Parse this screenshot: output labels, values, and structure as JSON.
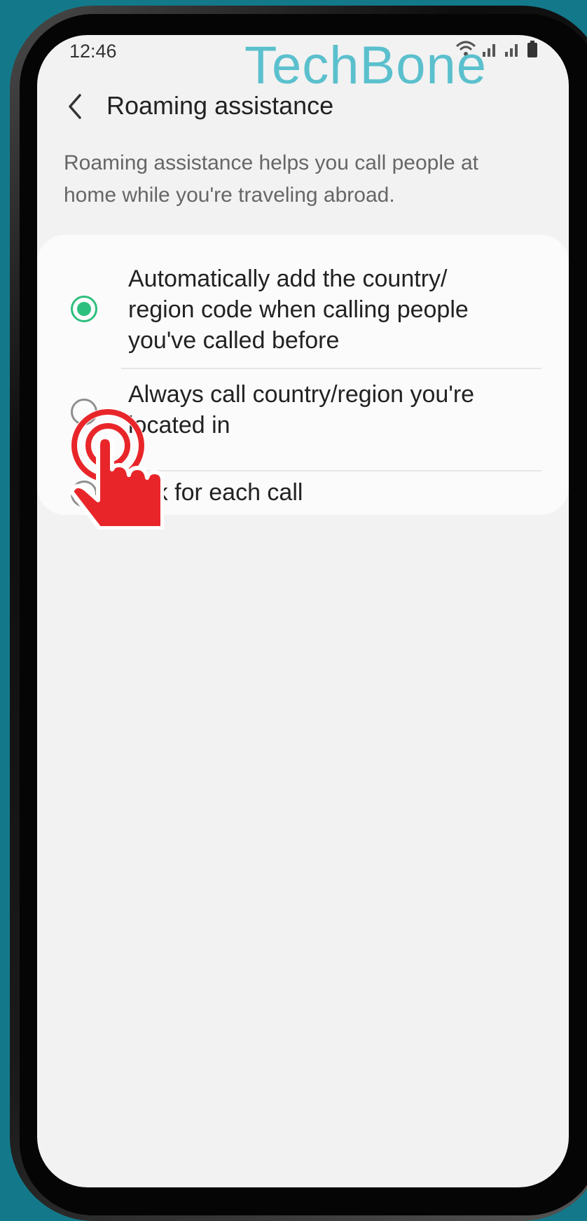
{
  "status_bar": {
    "time": "12:46",
    "icons": [
      "wifi-icon",
      "signal-icon",
      "signal-icon",
      "battery-icon"
    ]
  },
  "watermark": "TechBone",
  "header": {
    "back_icon": "chevron-left-icon",
    "title": "Roaming assistance"
  },
  "description": "Roaming assistance helps you call people at home while you're traveling abroad.",
  "options": [
    {
      "label": "Automatically add the country/ region code when calling people you've called before",
      "selected": true
    },
    {
      "label": "Always call country/region you're located in",
      "selected": false
    },
    {
      "label": "Ask for each call",
      "selected": false
    }
  ],
  "colors": {
    "accent": "#2dbf7d",
    "background": "#f2f2f2",
    "card": "#fbfbfb",
    "page_border": "#13798a",
    "watermark": "#5bc0cd",
    "tap_indicator": "#e8262a"
  },
  "overlay": {
    "icon": "tap-hand-icon"
  }
}
